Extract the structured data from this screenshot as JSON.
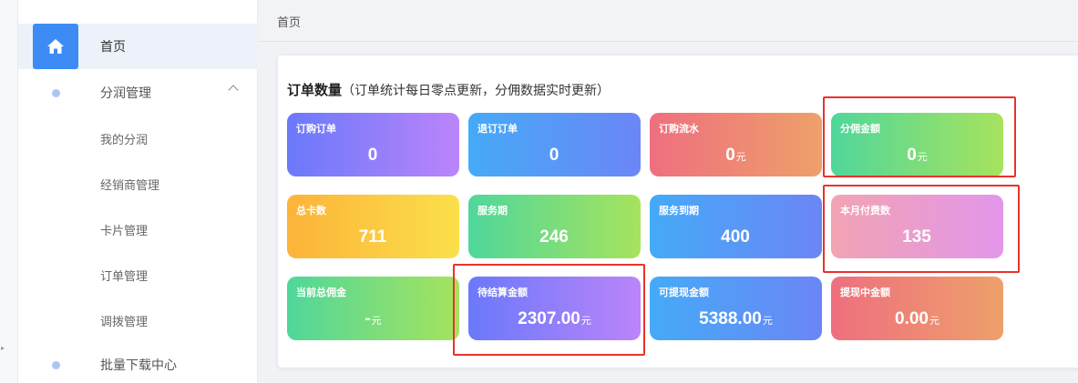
{
  "sidebar": {
    "items": [
      {
        "label": "首页",
        "icon": "home-icon",
        "active": true
      },
      {
        "label": "分润管理",
        "icon": "dot-icon",
        "expanded": true
      },
      {
        "label": "我的分润"
      },
      {
        "label": "经销商管理"
      },
      {
        "label": "卡片管理"
      },
      {
        "label": "订单管理"
      },
      {
        "label": "调拨管理"
      },
      {
        "label": "批量下载中心",
        "icon": "dot-icon"
      }
    ]
  },
  "header": {
    "breadcrumb": "首页"
  },
  "panel": {
    "title": "订单数量",
    "note": "（订单统计每日零点更新，分佣数据实时更新）",
    "cards": [
      {
        "title": "订购订单",
        "value": "0",
        "unit": "",
        "color": "#6a79fb"
      },
      {
        "title": "退订订单",
        "value": "0",
        "unit": "",
        "color": "#45aaf7"
      },
      {
        "title": "订购流水",
        "value": "0",
        "unit": "元",
        "color": "#ee6f7f"
      },
      {
        "title": "分佣金额",
        "value": "0",
        "unit": "元",
        "color": "#4fd79b"
      },
      {
        "title": "总卡数",
        "value": "711",
        "unit": "",
        "color": "#fcb33a"
      },
      {
        "title": "服务期",
        "value": "246",
        "unit": "",
        "color": "#4fd79b"
      },
      {
        "title": "服务到期",
        "value": "400",
        "unit": "",
        "color": "#45aaf7"
      },
      {
        "title": "本月付费数",
        "value": "135",
        "unit": "",
        "color": "#f2a3b3"
      },
      {
        "title": "当前总佣金",
        "value": "-",
        "unit": "元",
        "color": "#4fd79b"
      },
      {
        "title": "待结算金额",
        "value": "2307.00",
        "unit": "元",
        "color": "#6a79fb"
      },
      {
        "title": "可提现金额",
        "value": "5388.00",
        "unit": "元",
        "color": "#45aaf7"
      },
      {
        "title": "提现中金额",
        "value": "0.00",
        "unit": "元",
        "color": "#ee6f7f"
      }
    ]
  },
  "highlight_color": "#e8322d"
}
